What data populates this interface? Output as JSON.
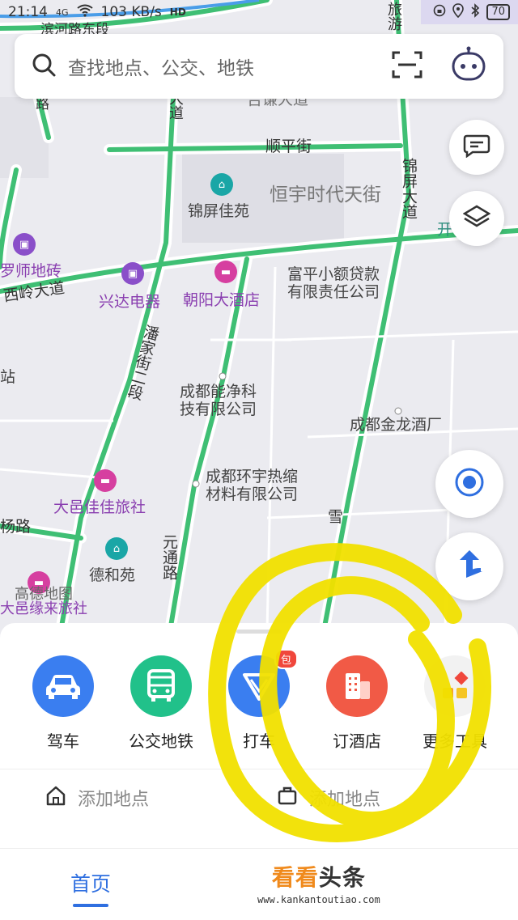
{
  "status": {
    "time": "21:14",
    "network": "4G",
    "speed": "103 KB/s",
    "hd": "HD",
    "battery": "70"
  },
  "search": {
    "placeholder": "查找地点、公交、地铁"
  },
  "map": {
    "labels": {
      "top_road": "滨河路东段",
      "dadao_top": "大道",
      "top_block": "吉谦大道",
      "jinping_dadao": "锦屏大道",
      "shunping": "顺平街",
      "lvyou": "旅游",
      "jinping_jiayuan": "锦屏佳苑",
      "hengyu": "恒宇时代天街",
      "kai": "开",
      "luoshi": "罗师地砖",
      "xiling": "西岭大道",
      "xingda": "兴达电器",
      "chaoyang": "朝阳大酒店",
      "fuping": "富平小额贷款",
      "fuping2": "有限责任公司",
      "panjia": "潘家街二段",
      "zhan": "站",
      "nengjing": "成都能净科",
      "nengjing2": "技有限公司",
      "jinlong": "成都金龙酒厂",
      "huanyu": "成都环宇热缩",
      "huanyu2": "材料有限公司",
      "dayi": "大邑佳佳旅社",
      "yang": "杨路",
      "yuantong": "元通路",
      "xue": "雪",
      "dehe": "德和苑",
      "gaode": "高德地图",
      "dayi2": "大邑缘来旅社",
      "lu_left": "路"
    }
  },
  "services": [
    {
      "label": "驾车",
      "color": "#3a7ef0"
    },
    {
      "label": "公交地铁",
      "color": "#21c18a"
    },
    {
      "label": "打车",
      "color": "#3a7ef0",
      "badge": "包"
    },
    {
      "label": "订酒店",
      "color": "#f15a46"
    },
    {
      "label": "更多工具",
      "color": "#f2f2f2"
    }
  ],
  "add_place": {
    "label": "添加地点",
    "second": "添加地点"
  },
  "tabbar": {
    "home": "首页"
  },
  "watermark": {
    "text_colored": "看看",
    "text_dark": "头条",
    "url": "www.kankantoutiao.com"
  },
  "colors": {
    "road_green": "#3fbf74",
    "accent_blue": "#2f6fe0",
    "annotation_yellow": "#f2e100"
  }
}
